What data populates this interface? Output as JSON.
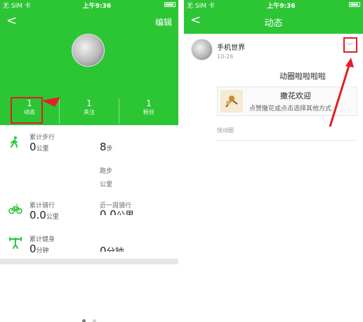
{
  "left": {
    "status": {
      "carrier": "无 SIM 卡",
      "time": "上午9:36"
    },
    "nav": {
      "back_icon": "<",
      "edit_label": "编辑"
    },
    "stats": [
      {
        "num": "1",
        "label": "动态"
      },
      {
        "num": "1",
        "label": "关注"
      },
      {
        "num": "1",
        "label": "粉丝"
      }
    ],
    "rows": {
      "steps_label": "累计步行",
      "steps_value": "0",
      "steps_unit": "公里",
      "steps_week_value": "8",
      "steps_week_unit": "步",
      "run_label": "跑步",
      "run_unit": "公里",
      "cycle_label": "累计骑行",
      "cycle_value": "0.0",
      "cycle_unit": "公里",
      "cycle_week_label": "近一周骑行",
      "cycle_week_value": "0.0",
      "cycle_week_unit": "公里",
      "fitness_label": "累计健身",
      "fitness_value": "0",
      "fitness_unit": "分钟",
      "fitness_week_value": "0",
      "fitness_week_unit": "分钟"
    },
    "colors": {
      "green": "#2cc534",
      "highlight": "#e21f26"
    }
  },
  "right": {
    "status": {
      "carrier": "无 SIM 卡",
      "time": "上午9:36"
    },
    "title": "动态",
    "post": {
      "user": "手机世界",
      "date": "10-26",
      "text": "动圈啦啦啦啦",
      "share_title": "撒花欢迎",
      "share_desc": "点赞撒花或点击选择其他方式",
      "footer": "悦动圈",
      "menu_icon": "chevron-down-icon"
    }
  }
}
